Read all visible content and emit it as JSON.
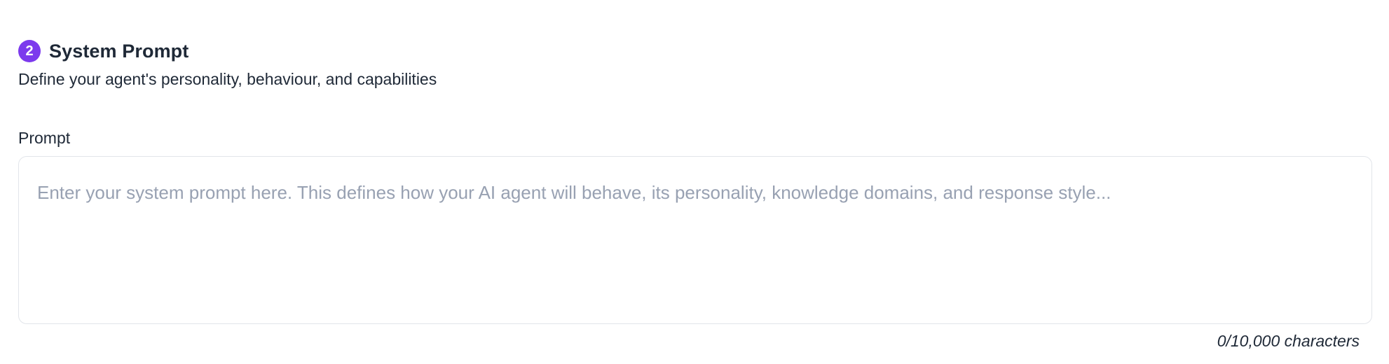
{
  "section": {
    "step_number": "2",
    "title": "System Prompt",
    "subtitle": "Define your agent's personality, behaviour, and capabilities"
  },
  "prompt_field": {
    "label": "Prompt",
    "value": "",
    "placeholder": "Enter your system prompt here. This defines how your AI agent will behave, its personality, knowledge domains, and response style...",
    "char_count": "0/10,000 characters"
  },
  "colors": {
    "badge": "#7c3aed",
    "text": "#1f2937",
    "placeholder": "#98a1b2",
    "border": "#e2e5ea"
  }
}
